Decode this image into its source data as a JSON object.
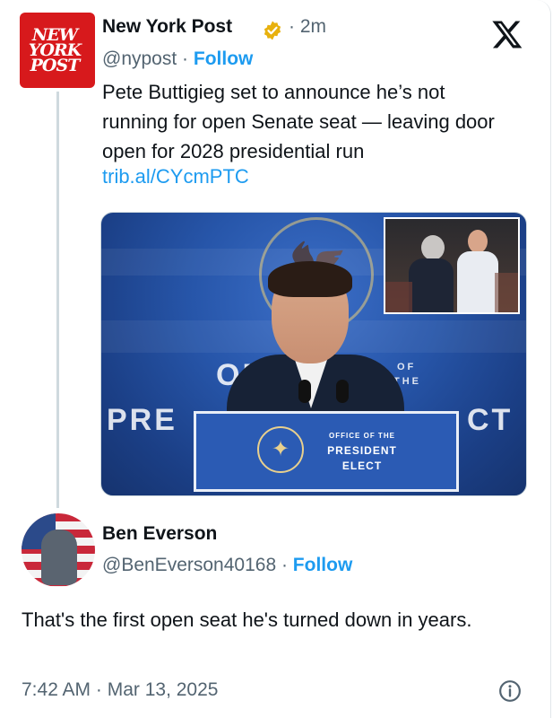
{
  "original_post": {
    "display_name": "New York Post",
    "time_ago": "· 2m",
    "handle": "@nypost",
    "separator": " · ",
    "follow_label": "Follow",
    "text": "Pete Buttigieg set to announce he’s not running for open Senate seat — leaving door open for 2028 presidential run",
    "link": "trib.al/CYcmPTC",
    "avatar_lines": [
      "NEW",
      "YORK",
      "POST"
    ],
    "verified_icon": "gold-verified-badge",
    "image": {
      "bg_word_left": "OF",
      "bg_word_of": "OF",
      "bg_word_the": "THE",
      "bg_word_pre": "PRE",
      "bg_word_ct": "CT",
      "podium_line1": "OFFICE OF THE",
      "podium_line2": "PRESIDENT",
      "podium_line3": "ELECT"
    }
  },
  "reply": {
    "display_name": "Ben Everson",
    "handle": "@BenEverson40168",
    "separator": " · ",
    "follow_label": "Follow",
    "text": "That's the first open seat he's turned down in years.",
    "timestamp": "7:42 AM · Mar 13, 2025"
  },
  "icons": {
    "x_logo": "x-logo-icon",
    "info": "info-icon"
  },
  "colors": {
    "link_blue": "#1d9bf0",
    "nyp_red": "#d7191c",
    "secondary_text": "#536471",
    "verified_gold": "#e8b10e"
  }
}
